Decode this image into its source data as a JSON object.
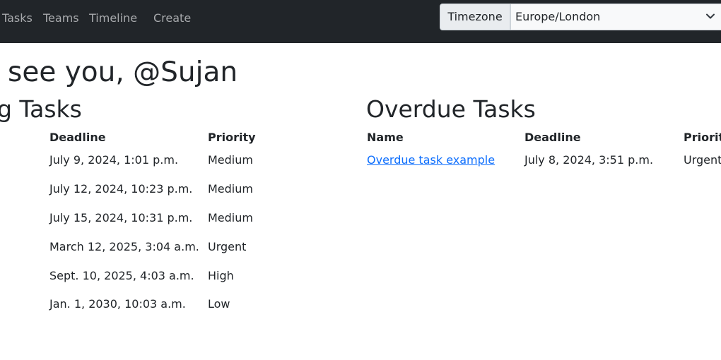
{
  "nav": {
    "links": [
      "Tasks",
      "Teams",
      "Timeline",
      "Create"
    ],
    "timezone_button": "Timezone",
    "timezone_value": "Europe/London"
  },
  "greeting": "see you, @Sujan",
  "upcoming": {
    "title": "g Tasks",
    "headers": [
      "Deadline",
      "Priority"
    ],
    "rows": [
      {
        "deadline": "July 9, 2024, 1:01 p.m.",
        "priority": "Medium"
      },
      {
        "deadline": "July 12, 2024, 10:23 p.m.",
        "priority": "Medium"
      },
      {
        "deadline": "July 15, 2024, 10:31 p.m.",
        "priority": "Medium"
      },
      {
        "deadline": "March 12, 2025, 3:04 a.m.",
        "priority": "Urgent"
      },
      {
        "deadline": "Sept. 10, 2025, 4:03 a.m.",
        "priority": "High"
      },
      {
        "deadline": "Jan. 1, 2030, 10:03 a.m.",
        "priority": "Low"
      }
    ]
  },
  "overdue": {
    "title": "Overdue Tasks",
    "headers": [
      "Name",
      "Deadline",
      "Priority"
    ],
    "rows": [
      {
        "name": "Overdue task example",
        "deadline": "July 8, 2024, 3:51 p.m.",
        "priority": "Urgent"
      }
    ]
  }
}
